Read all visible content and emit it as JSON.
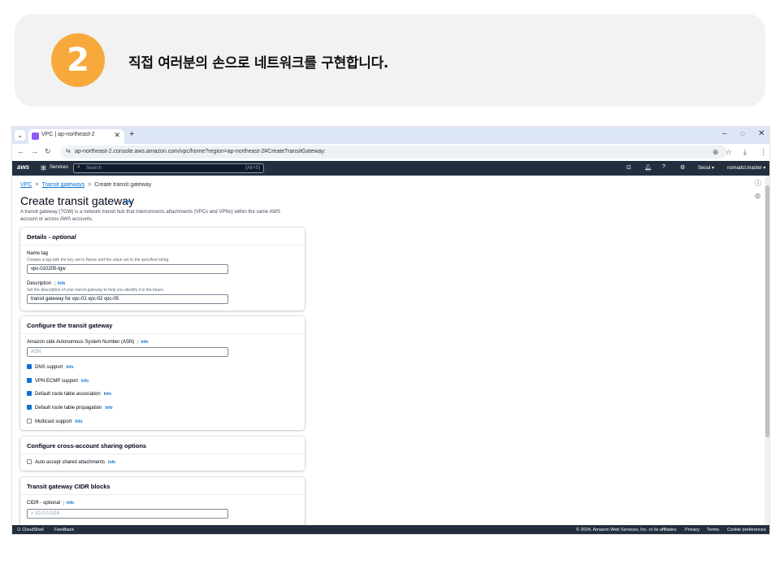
{
  "banner": {
    "step_number": "2",
    "title": "직접 여러분의 손으로 네트워크를 구현합니다."
  },
  "browser": {
    "tab_title": "VPC | ap-northeast-2",
    "url": "ap-northeast-2.console.aws.amazon.com/vpc/home?region=ap-northeast-2#CreateTransitGateway:"
  },
  "aws_header": {
    "logo": "aws",
    "services_label": "Services",
    "search_placeholder": "Search",
    "search_shortcut": "[Alt+S]",
    "region": "Seoul ▾",
    "user": "nomadcl.master ▾"
  },
  "breadcrumb": {
    "vpc": "VPC",
    "transit_gateways": "Transit gateways",
    "current": "Create transit gateway"
  },
  "page": {
    "title": "Create transit gateway",
    "info": "Info",
    "description": "A transit gateway (TGW) is a network transit hub that interconnects attachments (VPCs and VPNs) within the same AWS account or across AWS accounts."
  },
  "details": {
    "header": "Details",
    "header_optional": "- optional",
    "name_tag_label": "Name tag",
    "name_tag_hint": "Creates a tag with the key set to Name and the value set to the specified string.",
    "name_tag_value": "vpc-010205-tgw",
    "description_label": "Description",
    "description_info": "Info",
    "description_hint": "Set the description of your transit gateway to help you identify it in the future.",
    "description_value": "transit gateway for vpc-01 vpc-02 vpc-05"
  },
  "configure": {
    "header": "Configure the transit gateway",
    "asn_label": "Amazon side Autonomous System Number (ASN)",
    "asn_info": "Info",
    "asn_placeholder": "ASN",
    "options": [
      {
        "label": "DNS support",
        "info": "Info",
        "checked": true
      },
      {
        "label": "VPN ECMP support",
        "info": "Info",
        "checked": true
      },
      {
        "label": "Default route table association",
        "info": "Info",
        "checked": true
      },
      {
        "label": "Default route table propagation",
        "info": "Info",
        "checked": true
      },
      {
        "label": "Multicast support",
        "info": "Info",
        "checked": false
      }
    ]
  },
  "sharing": {
    "header": "Configure cross-account sharing options",
    "auto_accept_label": "Auto accept shared attachments",
    "auto_accept_info": "Info"
  },
  "cidr": {
    "header": "Transit gateway CIDR blocks",
    "label": "CIDR - optional",
    "info": "Info",
    "placeholder": "10.0.0.0/24"
  },
  "footer": {
    "cloudshell": "CloudShell",
    "feedback": "Feedback",
    "copyright": "© 2024, Amazon Web Services, Inc. or its affiliates.",
    "privacy": "Privacy",
    "terms": "Terms",
    "cookie": "Cookie preferences"
  }
}
